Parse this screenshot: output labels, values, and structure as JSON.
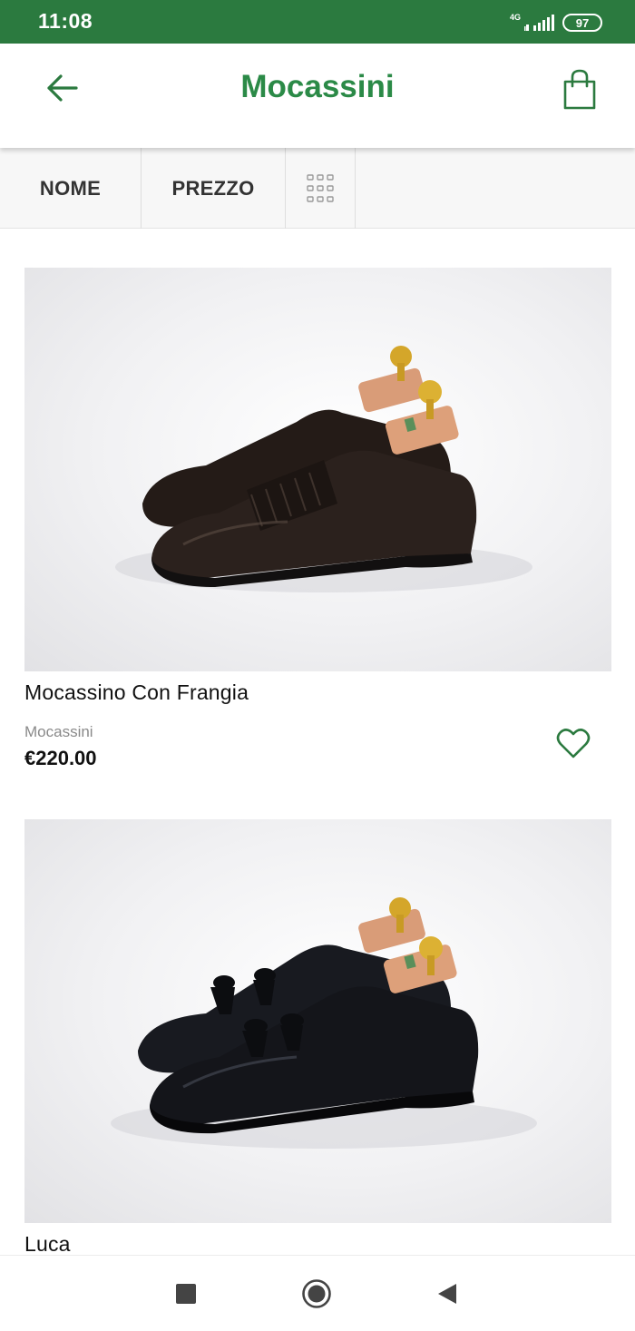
{
  "status_bar": {
    "time": "11:08",
    "network": "4G",
    "battery": "97"
  },
  "header": {
    "title": "Mocassini",
    "back_icon": "arrow-left-icon",
    "cart_icon": "shopping-bag-icon"
  },
  "filters": {
    "tabs": [
      {
        "label": "NOME"
      },
      {
        "label": "PREZZO"
      }
    ],
    "view_icon": "grid-view-icon"
  },
  "products": [
    {
      "name": "Mocassino Con Frangia",
      "category": "Mocassini",
      "price": "€220.00",
      "favorite_icon": "heart-outline-icon",
      "shoe_color": "#2b211d"
    },
    {
      "name": "Luca",
      "shoe_color": "#14151a"
    }
  ],
  "navigation": {
    "recent_icon": "square-icon",
    "home_icon": "circle-icon",
    "back_icon": "triangle-back-icon"
  },
  "colors": {
    "status_bar": "#2b7a3f",
    "accent": "#2b8a47",
    "filter_bg": "#f7f7f7"
  }
}
